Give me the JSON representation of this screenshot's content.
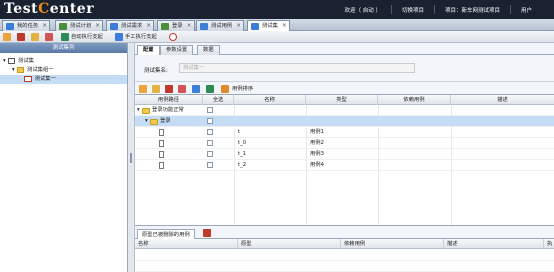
{
  "app": {
    "logo_prefix": "Test",
    "logo_accent": "C",
    "logo_suffix": "enter",
    "welcome": "欢迎（ 自动 ）",
    "switch_project": "切换项目",
    "project": "项目：新车网测试项目",
    "user": "用户"
  },
  "tabs": [
    {
      "label": "我的任务",
      "color": "#3b7dd8"
    },
    {
      "label": "测试计划",
      "color": "#4b8f3a"
    },
    {
      "label": "测试需求",
      "color": "#3b7dd8"
    },
    {
      "label": "登录",
      "color": "#4b8f3a"
    },
    {
      "label": "测试用例",
      "color": "#3b7dd8"
    },
    {
      "label": "测试集",
      "color": "#3b7dd8"
    }
  ],
  "toolbar": {
    "auto_run": "自动执行支起",
    "manual_run": "手工执行支起"
  },
  "left": {
    "header": "测试集列",
    "tree": [
      {
        "label": "测试集",
        "level": 0
      },
      {
        "label": "测试集组一",
        "level": 1
      },
      {
        "label": "测试集一",
        "level": 2
      }
    ]
  },
  "right": {
    "subtabs": [
      "配置",
      "参数设置",
      "数据"
    ],
    "form": {
      "label": "测试集名:",
      "value": "测试集一"
    },
    "gridbar": {
      "sort_label": "用例排序"
    },
    "grid": {
      "columns": [
        "用例路径",
        "全选",
        "名称",
        "类型",
        "依赖用例",
        "描述"
      ],
      "rows": [
        {
          "path": "登录功能正常",
          "name": "",
          "type": "",
          "level": 0,
          "folder": true
        },
        {
          "path": "登录",
          "name": "",
          "type": "",
          "level": 1,
          "folder": true
        },
        {
          "path": "",
          "name": "t",
          "type": "用例1",
          "level": 2,
          "folder": false
        },
        {
          "path": "",
          "name": "t_0",
          "type": "用例2",
          "level": 2,
          "folder": false
        },
        {
          "path": "",
          "name": "t_1",
          "type": "用例3",
          "level": 2,
          "folder": false
        },
        {
          "path": "",
          "name": "t_2",
          "type": "用例4",
          "level": 2,
          "folder": false
        }
      ]
    },
    "bottom": {
      "tab": "原型已被删除的用例",
      "columns": [
        "名称",
        "原型",
        "依赖用例",
        "描述",
        "执"
      ]
    }
  }
}
